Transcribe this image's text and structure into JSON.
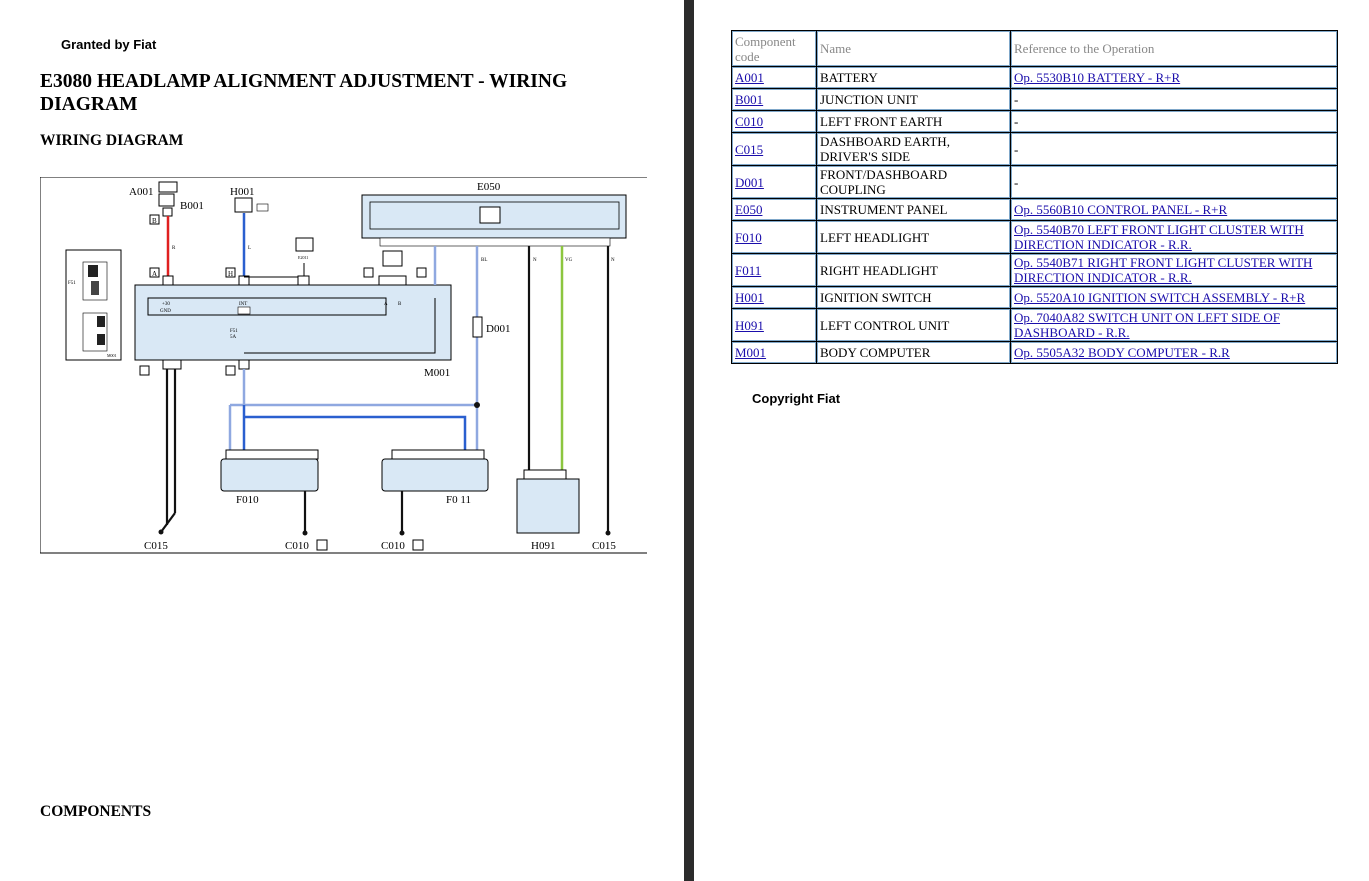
{
  "header": {
    "granted": "Granted by Fiat"
  },
  "title": "E3080 HEADLAMP ALIGNMENT ADJUSTMENT - WIRING DIAGRAM",
  "section_wiring": "WIRING DIAGRAM",
  "section_components": "COMPONENTS",
  "diagram": {
    "labels": {
      "a001": "A001",
      "b001": "B001",
      "h001": "H001",
      "e050": "E050",
      "d001": "D001",
      "m001": "M001",
      "f010": "F010",
      "f011": "F0 11",
      "h091": "H091",
      "c015_left": "C015",
      "c015_right": "C015",
      "c010_left": "C010",
      "c010_right": "C010"
    },
    "wire_colors": {
      "red": "#e02020",
      "blue": "#2a5fcf",
      "light_blue": "#8fa8e0",
      "black": "#111111",
      "green": "#8cc63f"
    }
  },
  "table": {
    "headers": {
      "code": "Component code",
      "name": "Name",
      "ref": "Reference to the Operation"
    },
    "rows": [
      {
        "code": "A001",
        "name": "BATTERY",
        "ref": "Op. 5530B10 BATTERY - R+R"
      },
      {
        "code": "B001",
        "name": "JUNCTION UNIT",
        "ref": "-"
      },
      {
        "code": "C010",
        "name": "LEFT FRONT EARTH",
        "ref": "-"
      },
      {
        "code": "C015",
        "name": "DASHBOARD EARTH, DRIVER'S SIDE",
        "ref": "-"
      },
      {
        "code": "D001",
        "name": "FRONT/DASHBOARD COUPLING",
        "ref": "-"
      },
      {
        "code": "E050",
        "name": "INSTRUMENT PANEL",
        "ref": "Op. 5560B10 CONTROL PANEL - R+R"
      },
      {
        "code": "F010",
        "name": "LEFT HEADLIGHT",
        "ref": "Op. 5540B70 LEFT FRONT LIGHT CLUSTER WITH DIRECTION INDICATOR - R.R."
      },
      {
        "code": "F011",
        "name": "RIGHT HEADLIGHT",
        "ref": "Op. 5540B71 RIGHT FRONT LIGHT CLUSTER WITH DIRECTION INDICATOR - R.R."
      },
      {
        "code": "H001",
        "name": "IGNITION SWITCH",
        "ref": "Op. 5520A10 IGNITION SWITCH ASSEMBLY - R+R"
      },
      {
        "code": "H091",
        "name": "LEFT CONTROL UNIT",
        "ref": "Op. 7040A82 SWITCH UNIT ON LEFT SIDE OF DASHBOARD - R.R."
      },
      {
        "code": "M001",
        "name": "BODY COMPUTER",
        "ref": "Op. 5505A32 BODY COMPUTER - R.R"
      }
    ]
  },
  "footer": {
    "copyright": "Copyright Fiat"
  }
}
